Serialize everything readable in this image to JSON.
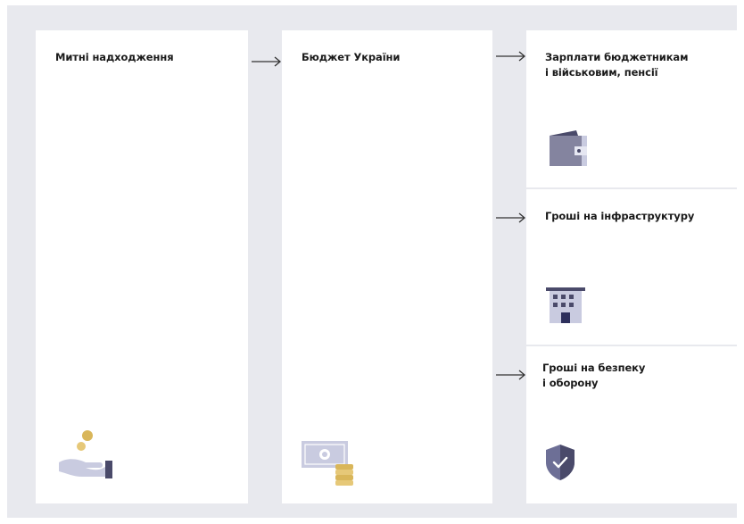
{
  "nodes": {
    "customs": {
      "label": "Митні надходження",
      "icon": "coins-hand-icon"
    },
    "budget": {
      "label": "Бюджет України",
      "icon": "banknote-coins-icon"
    },
    "salaries": {
      "label_line1": "Зарплати бюджетникам",
      "label_line2": "і військовим, пенсії",
      "icon": "wallet-icon"
    },
    "infrastructure": {
      "label": "Гроші на інфраструктуру",
      "icon": "building-icon"
    },
    "defense": {
      "label_line1": "Гроші на безпеку",
      "label_line2": "і оборону",
      "icon": "shield-check-icon"
    }
  },
  "colors": {
    "background": "#e8e9ee",
    "card": "#ffffff",
    "icon_primary": "#4a4a6a",
    "icon_light": "#c9cbe0",
    "coin": "#d9b65a",
    "text": "#1a1a1a"
  }
}
